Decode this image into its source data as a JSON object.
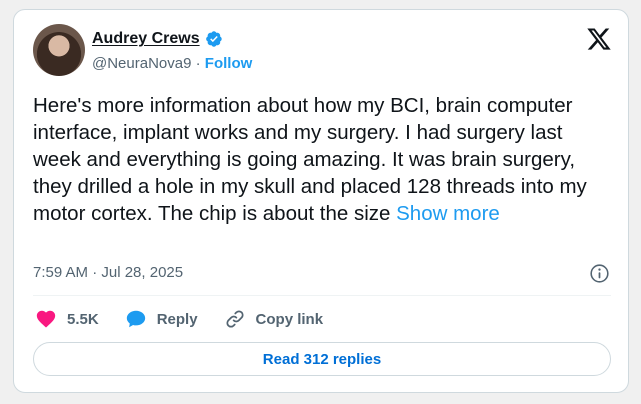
{
  "author": {
    "name": "Audrey Crews",
    "handle": "@NeuraNova9",
    "separator": "·",
    "follow_label": "Follow"
  },
  "post": {
    "text": "Here's more information about how my BCI, brain computer interface, implant works and my surgery. I had surgery last week and everything is going amazing. It was brain surgery, they drilled a hole in my skull and placed 128 threads into my motor cortex. The chip is about the size",
    "show_more_label": "Show more",
    "timestamp": "7:59 AM · Jul 28, 2025"
  },
  "actions": {
    "likes_count": "5.5K",
    "reply_label": "Reply",
    "copy_link_label": "Copy link"
  },
  "read_replies_label": "Read 312 replies",
  "icons": {
    "verified": "verified-badge-icon",
    "platform": "x-logo-icon",
    "info": "info-icon",
    "like": "heart-icon",
    "reply": "speech-bubble-icon",
    "copy_link": "link-icon"
  },
  "colors": {
    "accent": "#1d9bf0",
    "like": "#f91880",
    "text": "#0f1419",
    "muted": "#536471",
    "border": "#cfd9de"
  }
}
